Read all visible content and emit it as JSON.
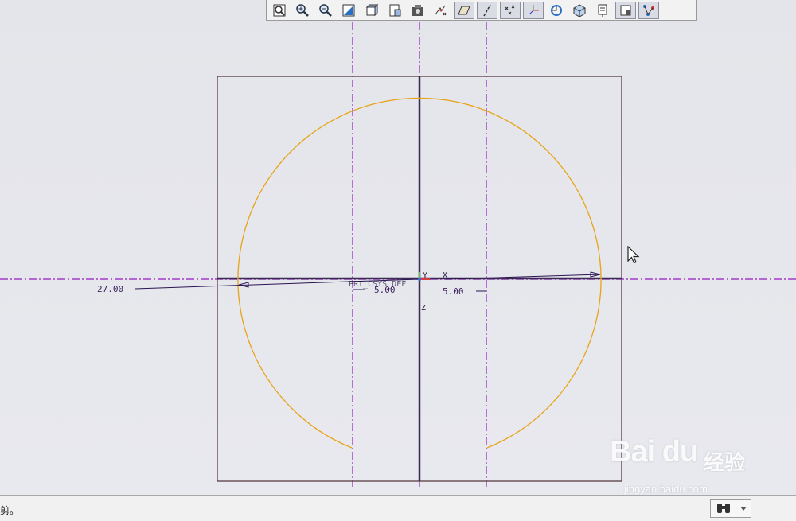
{
  "toolbar": {
    "buttons": [
      {
        "name": "refit-icon"
      },
      {
        "name": "zoom-in-icon"
      },
      {
        "name": "zoom-out-icon"
      },
      {
        "name": "repaint-icon"
      },
      {
        "name": "view-orient-icon"
      },
      {
        "name": "saved-views-icon"
      },
      {
        "name": "view-manager-icon"
      },
      {
        "name": "display-style-icon"
      },
      {
        "name": "datum-plane-display-icon",
        "pressed": true
      },
      {
        "name": "datum-axis-display-icon",
        "pressed": true
      },
      {
        "name": "point-display-icon",
        "pressed": true
      },
      {
        "name": "csys-display-icon",
        "pressed": true
      },
      {
        "name": "spin-center-icon"
      },
      {
        "name": "3d-view-icon"
      },
      {
        "name": "sketch-view-icon"
      },
      {
        "name": "sketcher-display-icon",
        "pressed": true
      },
      {
        "name": "constraints-display-icon",
        "pressed": true
      }
    ]
  },
  "sketch": {
    "dimensions": {
      "radius_left": "27.00",
      "offset_center": "5.00",
      "offset_right": "5.00"
    },
    "csys_label": "PRT_CSYS_DEF",
    "axis_labels": {
      "x": "X",
      "y": "Y",
      "z": "Z"
    },
    "colors": {
      "arc": "#e8a317",
      "datum": "#a33cc6",
      "rectangle": "#5a3d44",
      "dimension": "#2a1452"
    }
  },
  "status_bar": {
    "message": "剪。",
    "filter_icon": "binoculars-icon"
  },
  "watermark": {
    "brand": "Bai du",
    "suffix": "经验",
    "url": "jingyan.baidu.com"
  }
}
